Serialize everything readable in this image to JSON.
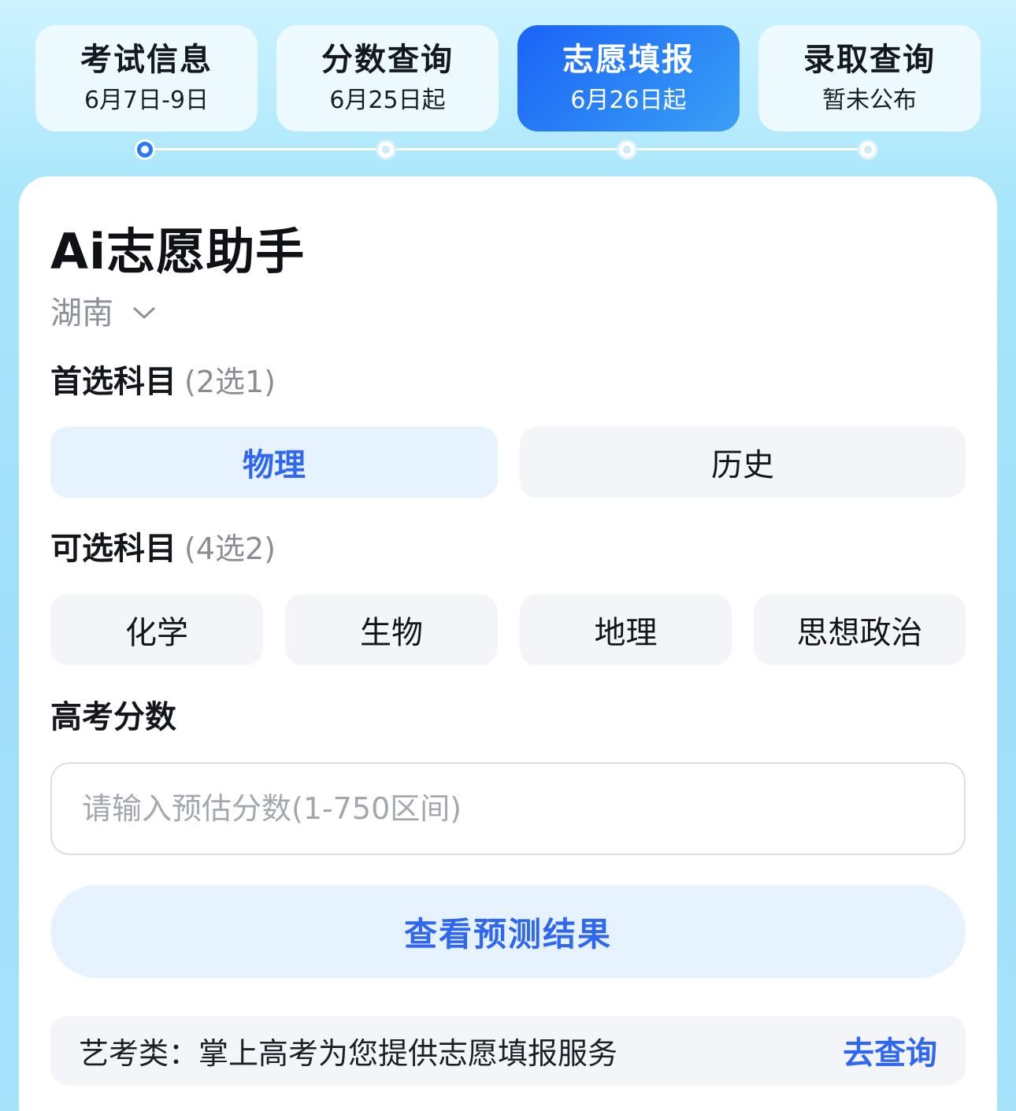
{
  "steps": [
    {
      "title": "考试信息",
      "sub": "6月7日-9日",
      "active": false
    },
    {
      "title": "分数查询",
      "sub": "6月25日起",
      "active": false
    },
    {
      "title": "志愿填报",
      "sub": "6月26日起",
      "active": true
    },
    {
      "title": "录取查询",
      "sub": "暂未公布",
      "active": false
    }
  ],
  "card": {
    "title": "Ai志愿助手",
    "region": "湖南",
    "primary": {
      "label": "首选科目",
      "hint": "(2选1)",
      "options": [
        "物理",
        "历史"
      ],
      "selected": "物理"
    },
    "optional": {
      "label": "可选科目",
      "hint": "(4选2)",
      "options": [
        "化学",
        "生物",
        "地理",
        "思想政治"
      ]
    },
    "score": {
      "label": "高考分数",
      "placeholder": "请输入预估分数(1-750区间)",
      "value": ""
    },
    "predict_label": "查看预测结果",
    "art": {
      "text": "艺考类：掌上高考为您提供志愿填报服务",
      "link": "去查询"
    }
  },
  "colors": {
    "accent": "#2f67f0",
    "active_tab_start": "#1a63f6",
    "active_tab_end": "#3aa0f6",
    "selected_bg": "#e6f2fe",
    "option_bg": "#f3f5f8"
  },
  "icons": {
    "region_dropdown": "chevron-down-icon"
  }
}
